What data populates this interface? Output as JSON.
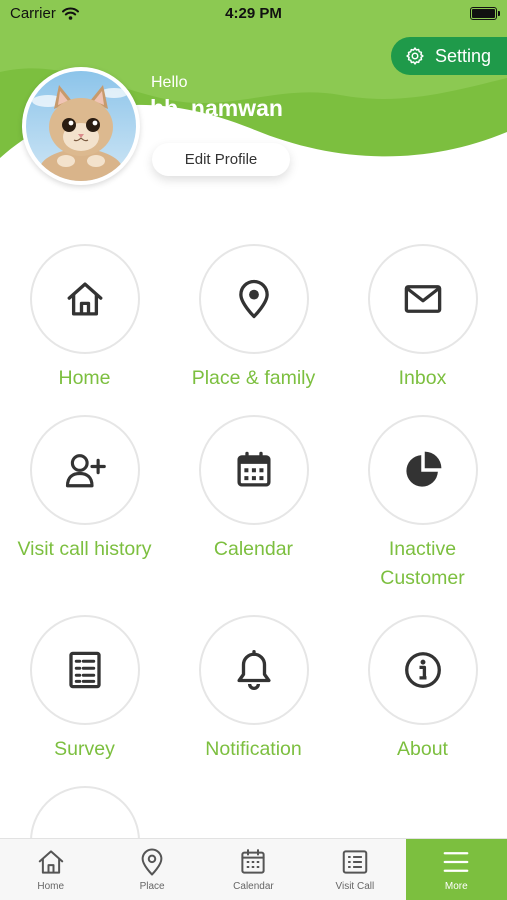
{
  "status_bar": {
    "carrier": "Carrier",
    "time": "4:29 PM"
  },
  "colors": {
    "brand_green": "#7cbf3f",
    "setting_green": "#1f9a4a",
    "icon_dark": "#333333"
  },
  "header": {
    "setting_label": "Setting",
    "greeting": "Hello",
    "username": "bb_namwan",
    "edit_profile_label": "Edit Profile",
    "avatar_icon": "cat-avatar"
  },
  "menu": [
    {
      "label": "Home",
      "icon": "home-icon"
    },
    {
      "label": "Place & family",
      "icon": "map-pin-icon"
    },
    {
      "label": "Inbox",
      "icon": "envelope-icon"
    },
    {
      "label": "Visit call history",
      "icon": "add-user-icon"
    },
    {
      "label": "Calendar",
      "icon": "calendar-icon"
    },
    {
      "label": "Inactive Customer",
      "icon": "pie-chart-icon"
    },
    {
      "label": "Survey",
      "icon": "checklist-icon"
    },
    {
      "label": "Notification",
      "icon": "bell-icon"
    },
    {
      "label": "About",
      "icon": "info-icon"
    },
    {
      "label": "",
      "icon": "share-icon"
    }
  ],
  "bottom_nav": [
    {
      "label": "Home",
      "icon": "home-icon"
    },
    {
      "label": "Place",
      "icon": "map-pin-icon"
    },
    {
      "label": "Calendar",
      "icon": "calendar-icon"
    },
    {
      "label": "Visit Call",
      "icon": "list-icon"
    },
    {
      "label": "More",
      "icon": "hamburger-icon",
      "active": true
    }
  ]
}
